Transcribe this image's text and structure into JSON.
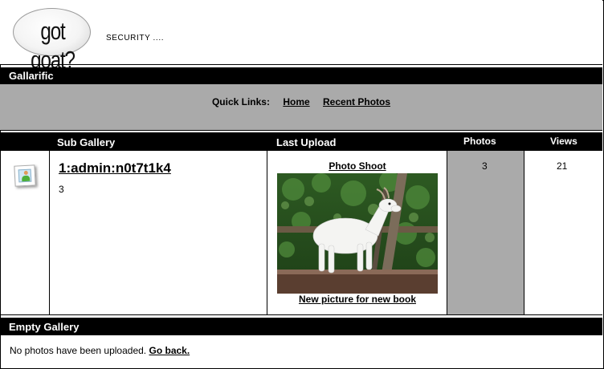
{
  "header": {
    "logo_text": "got goat?",
    "tagline": "SECURITY ...."
  },
  "gallery_bar": {
    "title": "Gallarific"
  },
  "quick_links": {
    "label": "Quick Links:",
    "links": [
      {
        "label": "Home"
      },
      {
        "label": "Recent Photos"
      }
    ]
  },
  "table": {
    "columns": {
      "sub_gallery": "Sub Gallery",
      "last_upload": "Last Upload",
      "photos": "Photos",
      "views": "Views"
    },
    "row": {
      "name": "1:admin:n0t7t1k4",
      "count": "3",
      "last_upload_title": "Photo Shoot",
      "last_upload_caption": "New picture for new book",
      "photos": "3",
      "views": "21"
    }
  },
  "empty_gallery": {
    "title": "Empty Gallery",
    "message": "No photos have been uploaded.",
    "link": "Go back."
  },
  "colors": {
    "bar": "#000000",
    "panel": "#aaaaaa",
    "background": "#ffffff"
  },
  "icons": {
    "gallery": "gallery-thumbnail-icon"
  }
}
